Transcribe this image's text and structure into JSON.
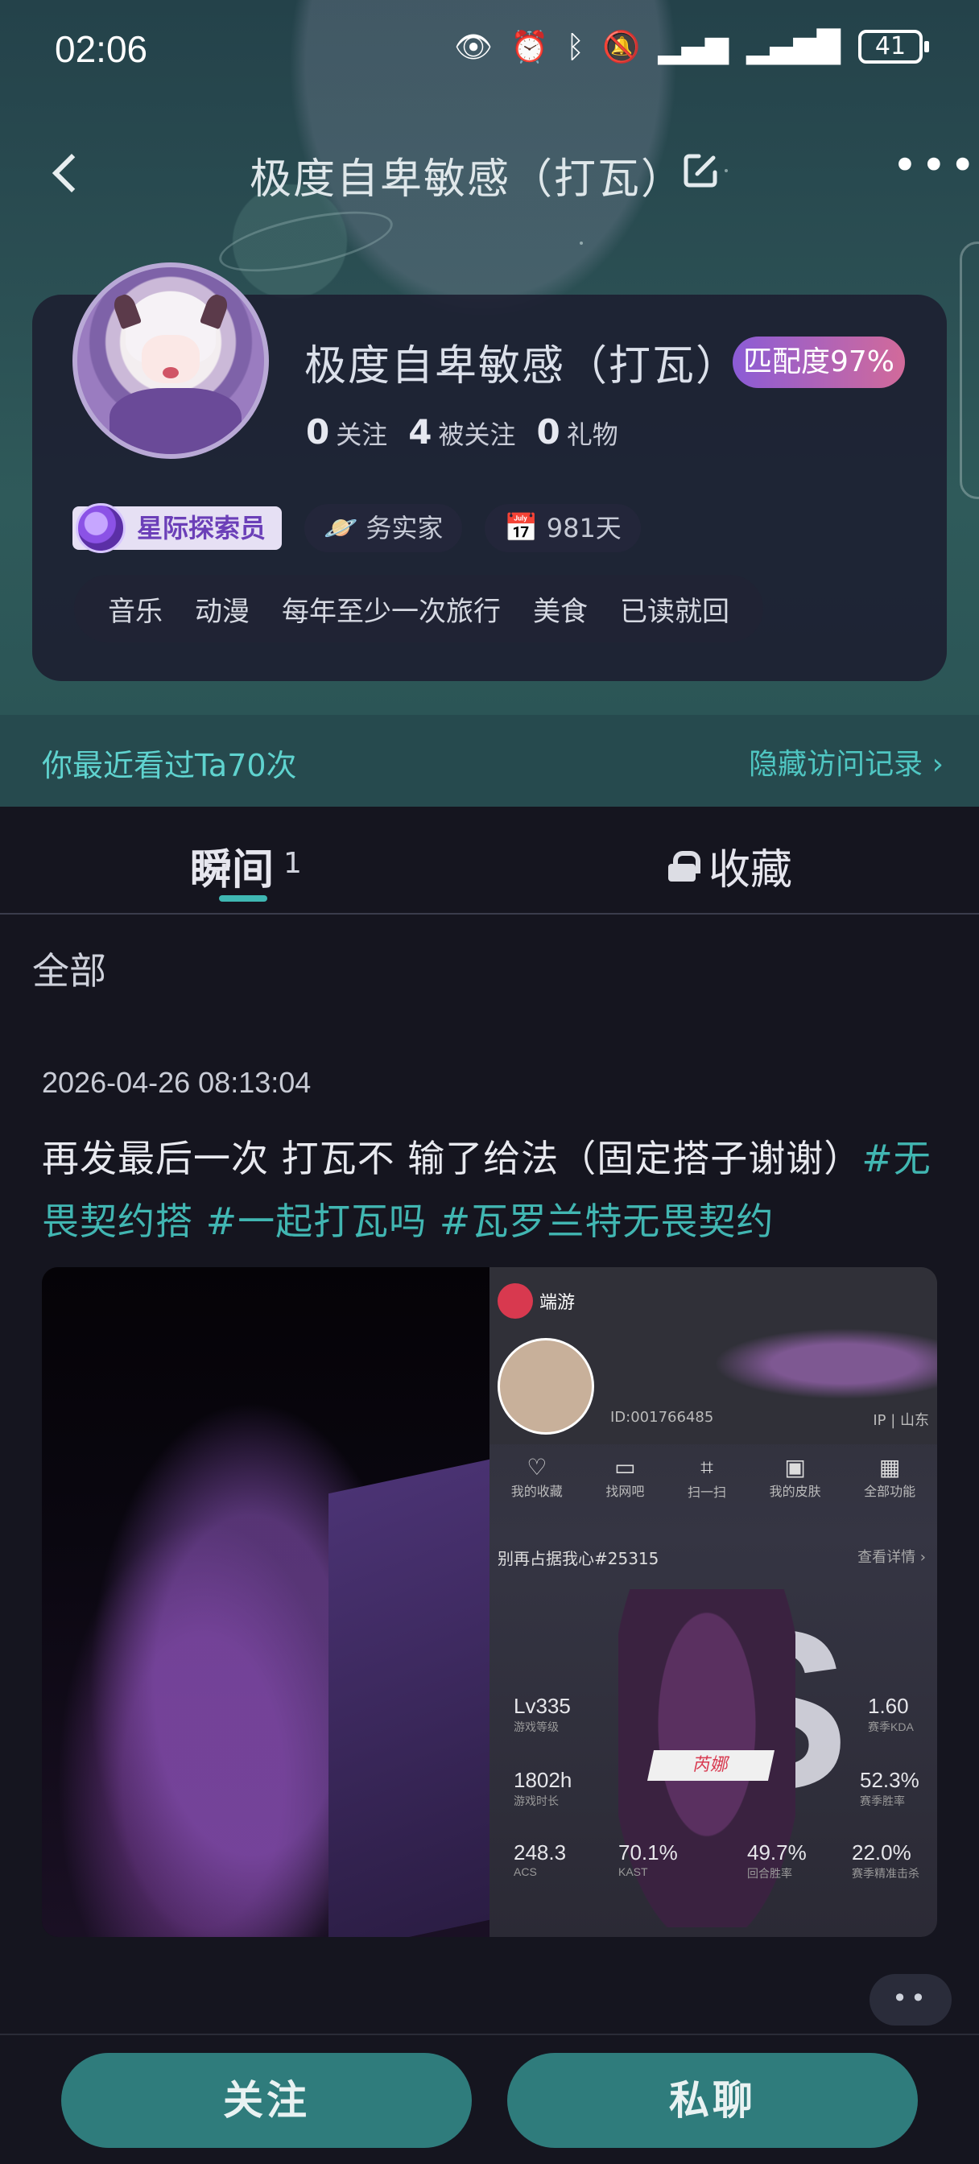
{
  "status_bar": {
    "time": "02:06",
    "battery": "41",
    "icons": [
      "eye-icon",
      "alarm-icon",
      "bluetooth-icon",
      "mute-icon",
      "signal-icon",
      "signal-icon"
    ]
  },
  "nav": {
    "title": "极度自卑敏感（打瓦）",
    "more": "•••"
  },
  "profile": {
    "name": "极度自卑敏感（打瓦）",
    "match_badge": "匹配度97%",
    "stats": [
      {
        "num": "0",
        "label": "关注"
      },
      {
        "num": "4",
        "label": "被关注"
      },
      {
        "num": "0",
        "label": "礼物"
      }
    ],
    "role_badge": "星际探索员",
    "trait": "务实家",
    "days": "981天",
    "interests": [
      "音乐",
      "动漫",
      "每年至少一次旅行",
      "美食",
      "已读就回"
    ]
  },
  "visit": {
    "left": "你最近看过Ta70次",
    "right": "隐藏访问记录 ›"
  },
  "tabs": {
    "moments": "瞬间",
    "moments_count": "1",
    "favorites": "收藏"
  },
  "feed": {
    "filter": "全部",
    "post": {
      "time": "2026-04-26 08:13:04",
      "text": "再发最后一次  打瓦不  输了给法（固定搭子谢谢）",
      "hashtags": [
        "#无畏契约搭",
        "#一起打瓦吗",
        "#瓦罗兰特无畏契约"
      ],
      "screenshot": {
        "app_name": "端游",
        "id": "ID:001766485",
        "ip": "IP | 山东",
        "menu": [
          "我的收藏",
          "找网吧",
          "扫一扫",
          "我的皮肤",
          "全部功能"
        ],
        "banner": "别再占据我心#25315",
        "details": "查看详情 ›",
        "agent": "芮娜",
        "stats": [
          {
            "value": "Lv335",
            "label": "游戏等级"
          },
          {
            "value": "1.60",
            "label": "赛季KDA"
          },
          {
            "value": "1802h",
            "label": "游戏时长"
          },
          {
            "value": "52.3%",
            "label": "赛季胜率"
          },
          {
            "value": "248.3",
            "label": "ACS"
          },
          {
            "value": "70.1%",
            "label": "KAST"
          },
          {
            "value": "49.7%",
            "label": "回合胜率"
          },
          {
            "value": "22.0%",
            "label": "赛季精准击杀"
          }
        ]
      }
    },
    "more_fab": "••"
  },
  "actions": {
    "follow": "关注",
    "chat": "私聊"
  }
}
